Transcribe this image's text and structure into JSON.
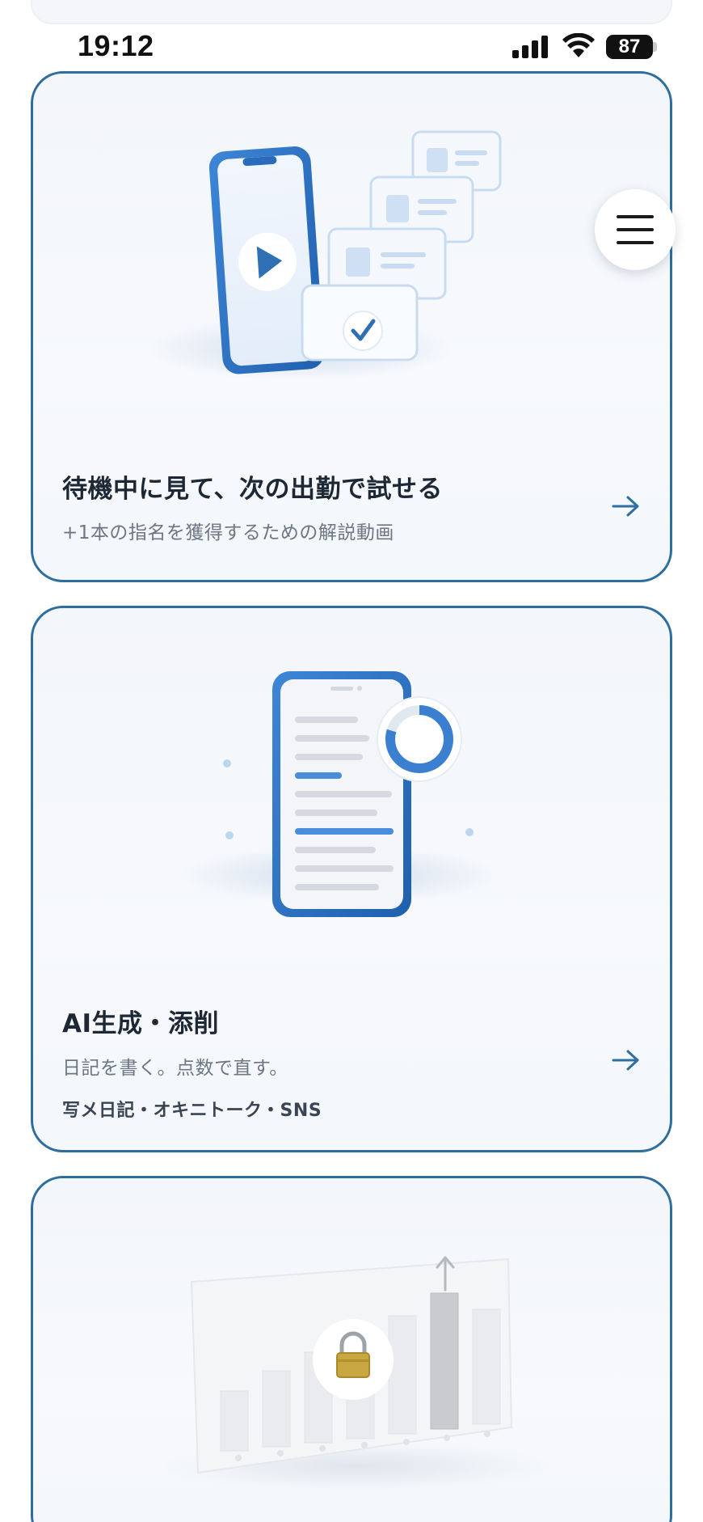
{
  "status_bar": {
    "time": "19:12",
    "battery": "87",
    "signal_icon": "cellular-signal-icon",
    "wifi_icon": "wifi-icon"
  },
  "menu": {
    "icon": "hamburger-menu-icon"
  },
  "cards": [
    {
      "title": "待機中に見て、次の出勤で試せる",
      "subtitle": "+1本の指名を獲得するための解説動画",
      "illustration": "phone-video-checklist-illustration",
      "arrow_icon": "arrow-right-icon"
    },
    {
      "title": "AI生成・添削",
      "subtitle": "日記を書く。点数で直す。",
      "tags": "写メ日記・オキニトーク・SNS",
      "illustration": "phone-document-score-illustration",
      "arrow_icon": "arrow-right-icon"
    },
    {
      "illustration": "locked-bar-chart-illustration",
      "lock_icon": "lock-icon"
    }
  ],
  "colors": {
    "card_border": "#2e6e9f",
    "accent_blue": "#2f6fb3",
    "arrow": "#2d6fa3",
    "title": "#1e2734",
    "subtitle": "#6d7683"
  }
}
